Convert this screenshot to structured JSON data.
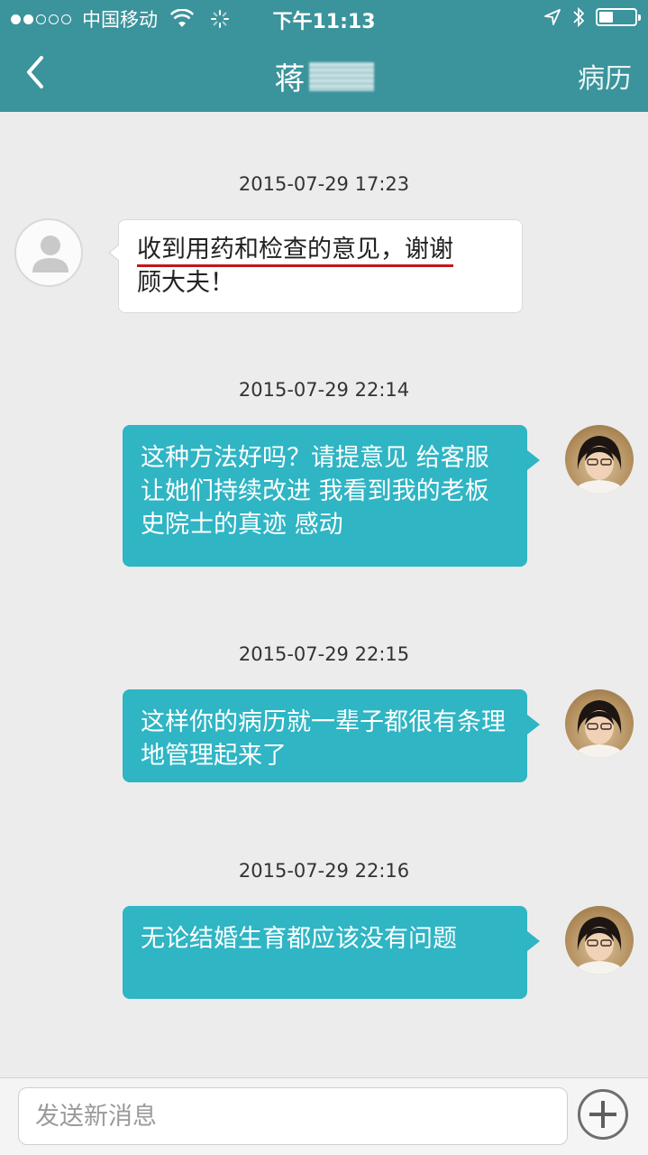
{
  "status_bar": {
    "carrier": "中国移动",
    "time": "下午11:13",
    "signal_icon": "signal-dots-icon",
    "wifi_icon": "wifi-icon",
    "loading_icon": "activity-spinner-icon",
    "location_icon": "location-arrow-icon",
    "bluetooth_icon": "bluetooth-icon",
    "battery_icon": "battery-icon",
    "battery_level": 0.4
  },
  "nav": {
    "back_icon": "chevron-left-icon",
    "title": "蒋",
    "right_label": "病历"
  },
  "messages": [
    {
      "timestamp": "2015-07-29 17:23",
      "side": "left",
      "line1": "收到用药和检查的意见，谢谢",
      "line2": "顾大夫！"
    },
    {
      "timestamp": "2015-07-29 22:14",
      "side": "right",
      "text": "这种方法好吗？请提意见 给客服 让她们持续改进 我看到我的老板史院士的真迹 感动"
    },
    {
      "timestamp": "2015-07-29 22:15",
      "side": "right",
      "text": "这样你的病历就一辈子都很有条理地管理起来了"
    },
    {
      "timestamp": "2015-07-29 22:16",
      "side": "right",
      "text": "无论结婚生育都应该没有问题"
    }
  ],
  "input": {
    "placeholder": "发送新消息",
    "add_icon": "plus-circle-icon"
  },
  "colors": {
    "header": "#3b939b",
    "bubble_right": "#2fb5c4",
    "underline": "#c01818"
  }
}
